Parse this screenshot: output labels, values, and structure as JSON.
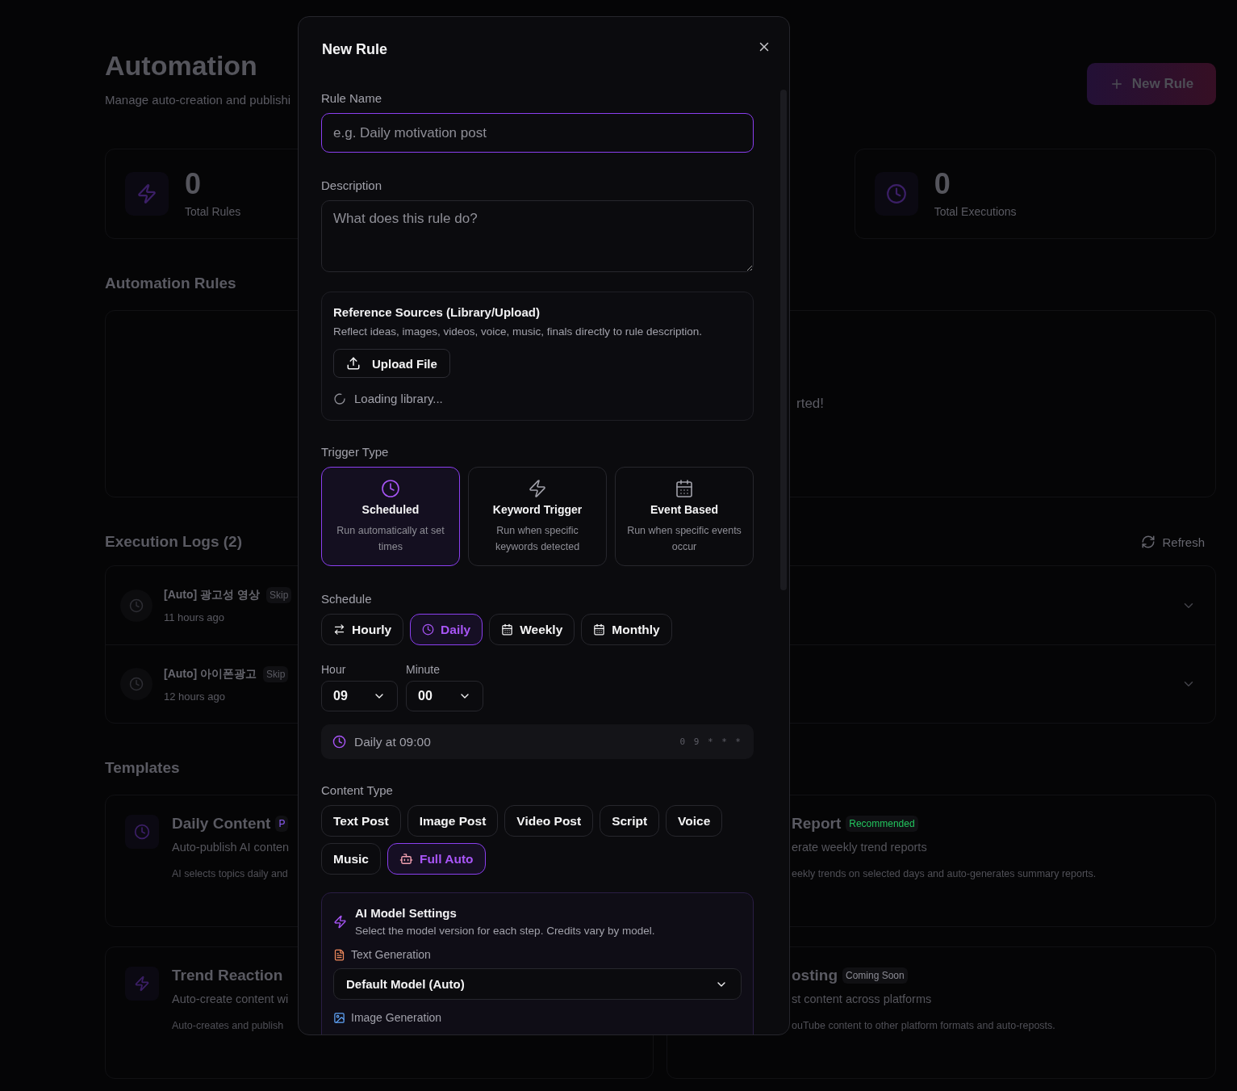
{
  "page": {
    "title": "Automation",
    "subtitle": "Manage auto-creation and publishi",
    "new_rule_button": "New Rule"
  },
  "stats": [
    {
      "kind": "rules",
      "value": "0",
      "label": "Total Rules"
    },
    {
      "kind": "executions",
      "value": "0",
      "label": "Total Executions"
    }
  ],
  "rules_section": {
    "title": "Automation Rules",
    "empty_text": "rted!"
  },
  "logs_section": {
    "title": "Execution Logs (2)",
    "refresh": "Refresh",
    "rows": [
      {
        "title": "[Auto] 광고성 영상",
        "status": "Skip",
        "time": "11 hours ago"
      },
      {
        "title": "[Auto] 아이폰광고",
        "status": "Skip",
        "time": "12 hours ago"
      }
    ]
  },
  "templates_section": {
    "title": "Templates",
    "left": [
      {
        "kind": "clock",
        "title": "Daily Content",
        "badge": "P",
        "color": "#8b5cf6",
        "subtitle": "Auto-publish AI conten",
        "detail": "AI selects topics daily and"
      },
      {
        "kind": "bolt",
        "title": "Trend Reaction",
        "subtitle": "Auto-create content wi",
        "detail": "Auto-creates and publish"
      }
    ],
    "right": [
      {
        "title": "Report",
        "badge": "Recommended",
        "color": "#22c55e",
        "subtitle": "erate weekly trend reports",
        "detail": "eekly trends on selected days and auto-generates summary reports."
      },
      {
        "title": "osting",
        "badge": "Coming Soon",
        "color": "#8a8a93",
        "subtitle": "st content across platforms",
        "detail": "ouTube content to other platform formats and auto-reposts."
      }
    ]
  },
  "modal": {
    "title": "New Rule",
    "rule_name": {
      "label": "Rule Name",
      "placeholder": "e.g. Daily motivation post"
    },
    "description": {
      "label": "Description",
      "placeholder": "What does this rule do?"
    },
    "reference": {
      "title": "Reference Sources (Library/Upload)",
      "description": "Reflect ideas, images, videos, voice, music, finals directly to rule description.",
      "upload_button": "Upload File",
      "loading": "Loading library..."
    },
    "trigger": {
      "label": "Trigger Type",
      "options": [
        {
          "kind": "scheduled",
          "title": "Scheduled",
          "description": "Run automatically at set times",
          "selected": true
        },
        {
          "kind": "keyword",
          "title": "Keyword Trigger",
          "description": "Run when specific keywords detected",
          "selected": false
        },
        {
          "kind": "event",
          "title": "Event Based",
          "description": "Run when specific events occur",
          "selected": false
        }
      ]
    },
    "schedule": {
      "label": "Schedule",
      "options": [
        {
          "kind": "hourly",
          "label": "Hourly",
          "selected": false
        },
        {
          "kind": "daily",
          "label": "Daily",
          "selected": true
        },
        {
          "kind": "weekly",
          "label": "Weekly",
          "selected": false
        },
        {
          "kind": "monthly",
          "label": "Monthly",
          "selected": false
        }
      ],
      "hour": {
        "label": "Hour",
        "value": "09"
      },
      "minute": {
        "label": "Minute",
        "value": "00"
      },
      "summary": "Daily at 09:00",
      "cron": "0 9 * * *"
    },
    "content_type": {
      "label": "Content Type",
      "options": [
        {
          "kind": "plain",
          "label": "Text Post",
          "selected": false
        },
        {
          "kind": "plain",
          "label": "Image Post",
          "selected": false
        },
        {
          "kind": "plain",
          "label": "Video Post",
          "selected": false
        },
        {
          "kind": "plain",
          "label": "Script",
          "selected": false
        },
        {
          "kind": "plain",
          "label": "Voice",
          "selected": false
        },
        {
          "kind": "plain",
          "label": "Music",
          "selected": false
        },
        {
          "kind": "robot",
          "label": "Full Auto",
          "selected": true
        }
      ]
    },
    "ai_settings": {
      "title": "AI Model Settings",
      "description": "Select the model version for each step. Credits vary by model.",
      "steps": [
        {
          "kind": "text",
          "label": "Text Generation",
          "value": "Default Model (Auto)"
        },
        {
          "kind": "image",
          "label": "Image Generation"
        }
      ]
    }
  }
}
